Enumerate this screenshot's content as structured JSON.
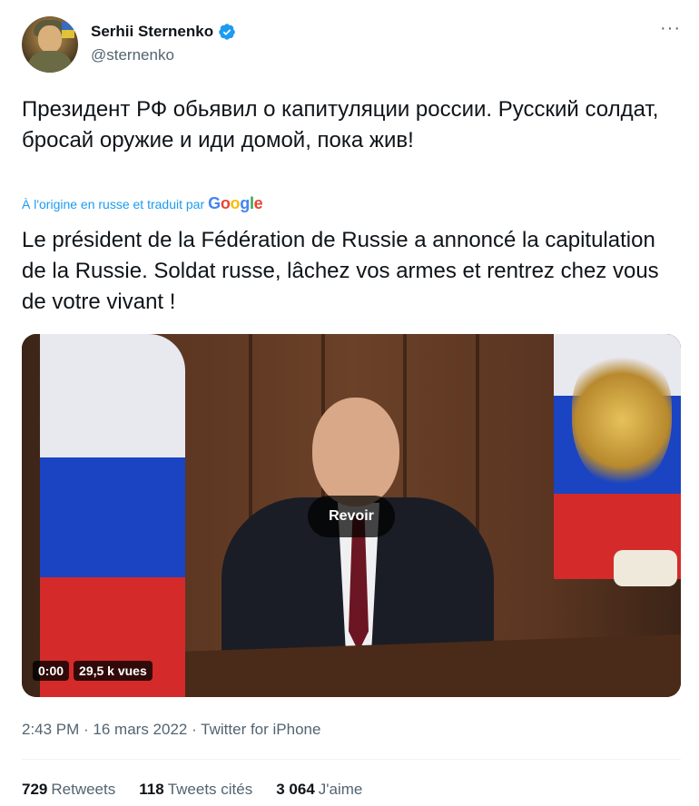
{
  "author": {
    "name": "Serhii Sternenko",
    "handle": "@sternenko",
    "verified": true,
    "more_label": "···"
  },
  "tweet": {
    "text": "Президент РФ обьявил о капитуляции россии. Русский солдат, бросай оружие и иди домой, пока жив!",
    "translated_by_label": "À l'origine en russe et traduit par",
    "translation_provider": "Google",
    "translation": "Le président de la Fédération de Russie a annoncé la capitulation de la Russie. Soldat russe, lâchez vos armes et rentrez chez vous de votre vivant !"
  },
  "media": {
    "replay_label": "Revoir",
    "time": "0:00",
    "views": "29,5 k vues"
  },
  "meta": {
    "line": "2:43 PM · 16 mars 2022 · Twitter for iPhone"
  },
  "stats": {
    "retweets_count": "729",
    "retweets_label": "Retweets",
    "quotes_count": "118",
    "quotes_label": "Tweets cités",
    "likes_count": "3 064",
    "likes_label": "J'aime"
  },
  "colors": {
    "link": "#1d9bf0",
    "secondary_text": "#536471",
    "primary_text": "#0f1419"
  }
}
